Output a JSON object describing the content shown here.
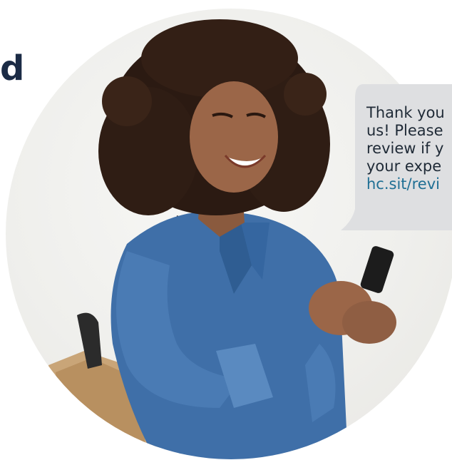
{
  "heading": {
    "fragment": "d",
    "color": "#1b2b45"
  },
  "photo": {
    "alt": "Smiling woman with curly hair in denim shirt looking at her phone"
  },
  "sms": {
    "lines": [
      "Thank you",
      "us! Please",
      "review if y",
      "your expe"
    ],
    "link": "hc.sit/revi",
    "bubble_color": "#dedfe1",
    "text_color": "#1f2a36",
    "link_color": "#1f6f94"
  }
}
